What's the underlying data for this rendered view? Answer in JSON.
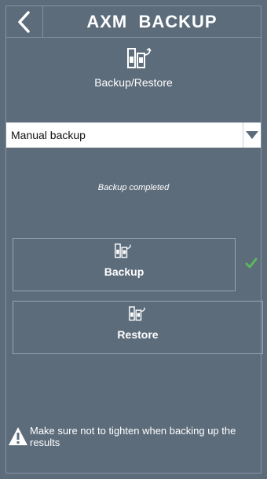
{
  "header": {
    "title": "AXM  BACKUP",
    "back_icon": "chevron-left-icon"
  },
  "section": {
    "icon": "backup-device-icon",
    "label": "Backup/Restore"
  },
  "mode_select": {
    "value": "Manual backup",
    "icon": "dropdown-arrow-icon"
  },
  "status": {
    "text": "Backup completed"
  },
  "buttons": {
    "backup": {
      "label": "Backup",
      "icon": "backup-device-icon",
      "done": true,
      "done_icon": "check-icon"
    },
    "restore": {
      "label": "Restore",
      "icon": "backup-device-icon"
    }
  },
  "warning": {
    "icon": "warning-icon",
    "text": "Make sure not to tighten when backing up the results"
  },
  "colors": {
    "background": "#5d6c7b",
    "check": "#5cb85c",
    "border": "#8592a0"
  }
}
